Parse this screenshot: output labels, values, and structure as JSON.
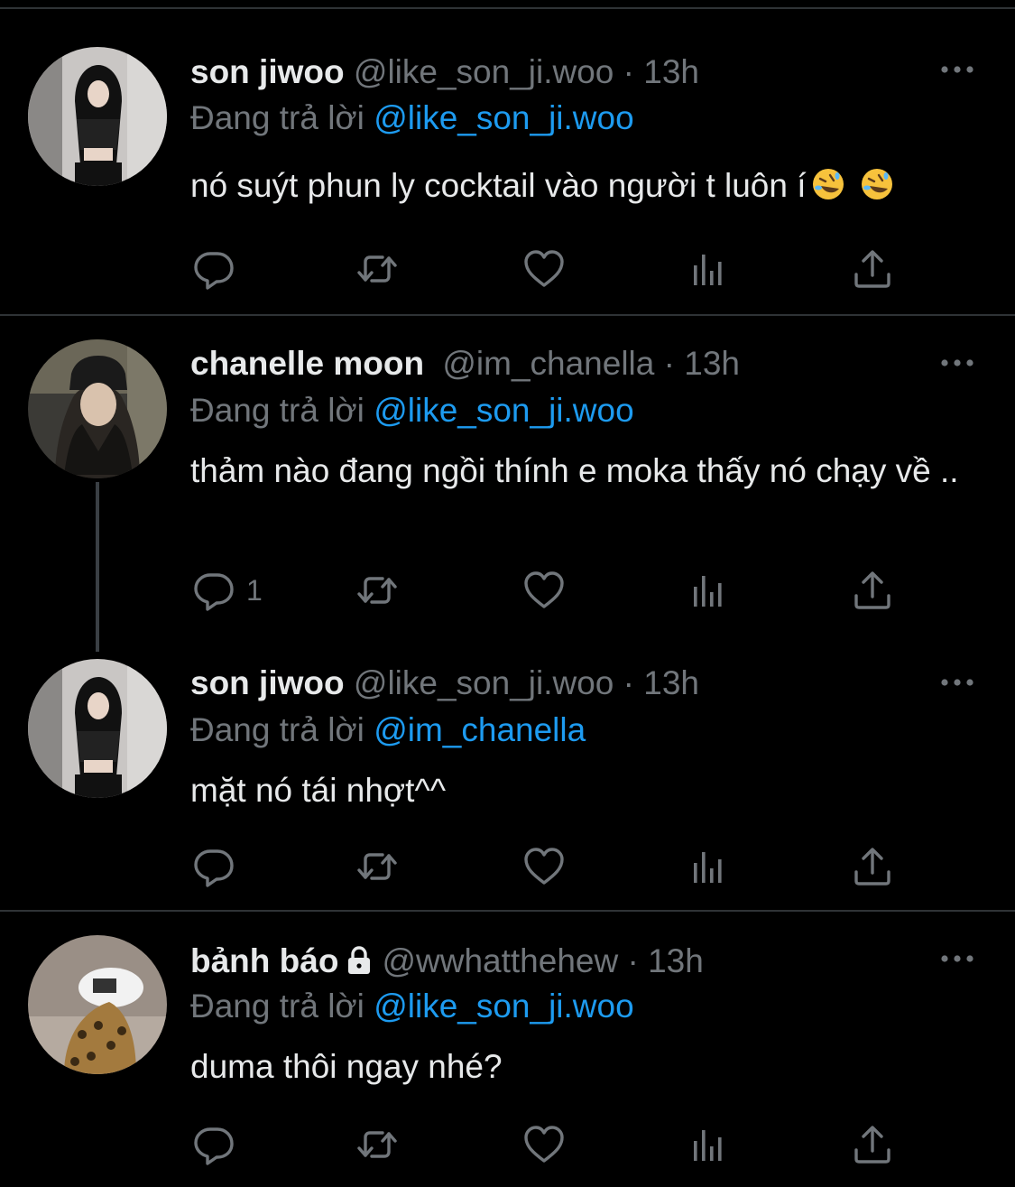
{
  "theme": {
    "background": "#000000",
    "text": "#e7e9ea",
    "muted": "#71767b",
    "accent": "#1d9bf0",
    "divider": "#2f3336"
  },
  "reply_prefix": "Đang trả lời",
  "tweets": [
    {
      "name": "son jiwoo",
      "handle": "@like_son_ji.woo",
      "separator": "·",
      "time": "13h",
      "reply_to": "@like_son_ji.woo",
      "text": "nó suýt phun ly cocktail vào người t luôn í",
      "emoji": [
        "rolling-on-floor-laughing-emoji",
        "rolling-on-floor-laughing-emoji"
      ],
      "reply_count": ""
    },
    {
      "name": "chanelle moon",
      "handle": "@im_chanella",
      "separator": "·",
      "time": "13h",
      "reply_to": "@like_son_ji.woo",
      "text": "thảm nào đang ngồi thính e moka thấy nó chạy về ..",
      "reply_count": "1"
    },
    {
      "name": "son jiwoo",
      "handle": "@like_son_ji.woo",
      "separator": "·",
      "time": "13h",
      "reply_to": "@im_chanella",
      "text": "mặt nó tái nhợt^^",
      "reply_count": ""
    },
    {
      "name": "bảnh báo",
      "handle": "@wwhatthehew",
      "separator": "·",
      "time": "13h",
      "reply_to": "@like_son_ji.woo",
      "text": "duma thôi ngay nhé?",
      "reply_count": "",
      "protected_icon": "lock-icon"
    }
  ],
  "icons": {
    "reply": "reply-bubble-icon",
    "retweet": "retweet-icon",
    "like": "heart-icon",
    "views": "analytics-bars-icon",
    "share": "share-upload-icon",
    "more": "more-dots-icon"
  }
}
